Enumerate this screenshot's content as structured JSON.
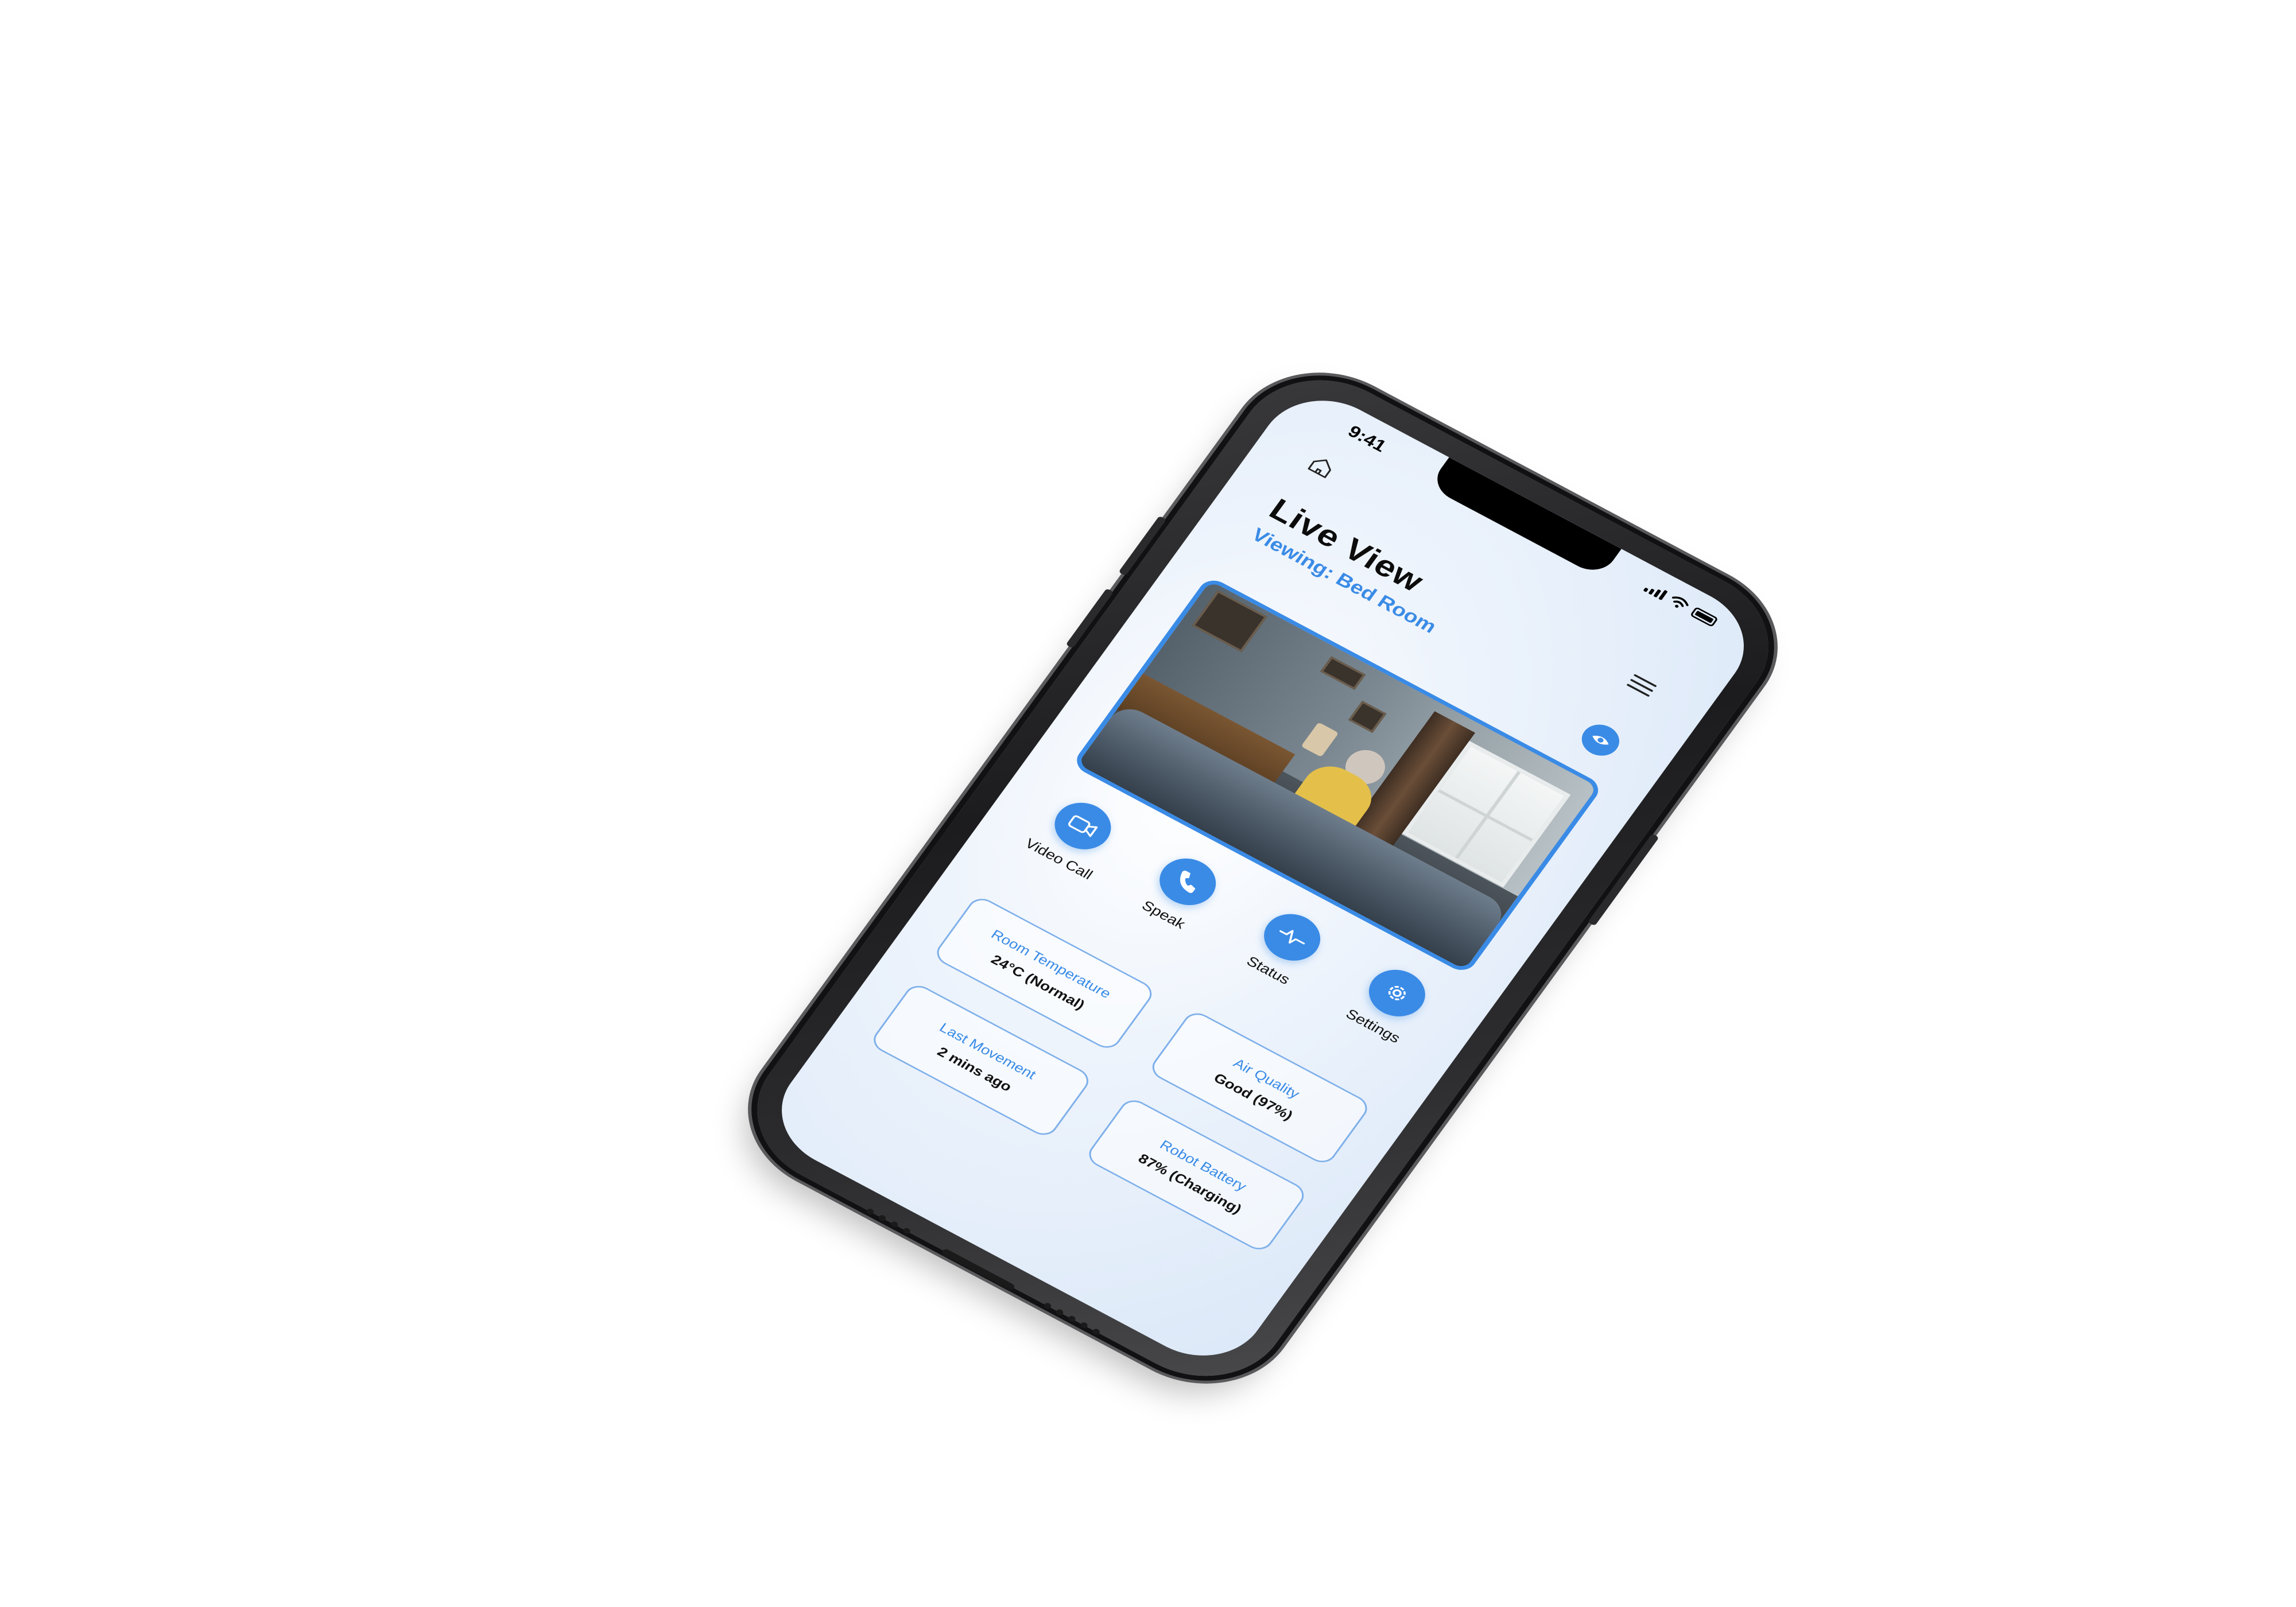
{
  "status_bar": {
    "time": "9:41"
  },
  "header": {
    "title": "Live View",
    "subtitle": "Viewing: Bed Room",
    "home_icon": "home-icon",
    "menu_icon": "menu-icon",
    "eye_icon": "eye-icon"
  },
  "actions": [
    {
      "label": "Video Call",
      "icon": "video-camera-icon"
    },
    {
      "label": "Speak",
      "icon": "phone-icon"
    },
    {
      "label": "Status",
      "icon": "pulse-icon"
    },
    {
      "label": "Settings",
      "icon": "gear-icon"
    }
  ],
  "stats": [
    {
      "title": "Room Temperature",
      "value": "24°C (Normal)"
    },
    {
      "title": "Air Quality",
      "value": "Good (97%)"
    },
    {
      "title": "Last Movement",
      "value": "2 mins ago"
    },
    {
      "title": "Robot Battery",
      "value": "87% (Charging)"
    }
  ],
  "colors": {
    "accent": "#3a8be6",
    "card_border": "#7fb0ea",
    "phone_frame": "#1c1c1e"
  }
}
